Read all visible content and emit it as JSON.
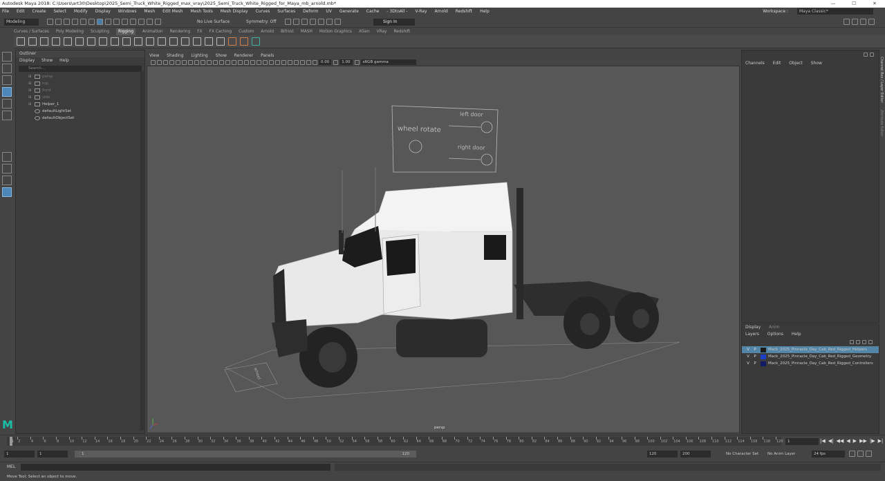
{
  "window": {
    "title": "Autodesk Maya 2018: C:\\Users\\art30\\Desktop\\2025_Semi_Truck_White_Rigged_max_vray\\2025_Semi_Truck_White_Rigged_for_Maya_mb_arnold.mb*",
    "minimize": "—",
    "maximize": "☐",
    "close": "✕"
  },
  "menus": [
    "File",
    "Edit",
    "Create",
    "Select",
    "Modify",
    "Display",
    "Windows",
    "Mesh",
    "Edit Mesh",
    "Mesh Tools",
    "Mesh Display",
    "Curves",
    "Surfaces",
    "Deform",
    "UV",
    "Generate",
    "Cache",
    "- 3DtoAll -",
    "V-Ray",
    "Arnold",
    "Redshift",
    "Help"
  ],
  "workspace": {
    "label": "Workspace :",
    "value": "Maya Classic*"
  },
  "status": {
    "mode": "Modeling",
    "live_surface": "No Live Surface",
    "symmetry": "Symmetry: Off",
    "sign_in": "Sign In"
  },
  "shelf_tabs": [
    {
      "label": "Curves / Surfaces"
    },
    {
      "label": "Poly Modeling"
    },
    {
      "label": "Sculpting"
    },
    {
      "label": "Rigging",
      "active": true
    },
    {
      "label": "Animation"
    },
    {
      "label": "Rendering"
    },
    {
      "label": "FX"
    },
    {
      "label": "FX Caching"
    },
    {
      "label": "Custom"
    },
    {
      "label": "Arnold"
    },
    {
      "label": "Bifrost"
    },
    {
      "label": "MASH"
    },
    {
      "label": "Motion Graphics"
    },
    {
      "label": "XGen"
    },
    {
      "label": "VRay"
    },
    {
      "label": "Redshift"
    }
  ],
  "outliner": {
    "title": "Outliner",
    "menu": [
      "Display",
      "Show",
      "Help"
    ],
    "search_placeholder": "Search...",
    "items": [
      {
        "label": "persp",
        "dim": true,
        "expandable": true
      },
      {
        "label": "top",
        "dim": true,
        "expandable": true
      },
      {
        "label": "front",
        "dim": true,
        "expandable": true
      },
      {
        "label": "side",
        "dim": true,
        "expandable": true
      },
      {
        "label": "Helper_1",
        "dim": false,
        "expandable": true
      },
      {
        "label": "defaultLightSet",
        "dim": false,
        "expandable": false
      },
      {
        "label": "defaultObjectSet",
        "dim": false,
        "expandable": false
      }
    ]
  },
  "viewport": {
    "menu": [
      "View",
      "Shading",
      "Lighting",
      "Show",
      "Renderer",
      "Panels"
    ],
    "exposure": "0.00",
    "gamma": "1.00",
    "color_space": "sRGB gamma",
    "camera": "persp",
    "helpers": {
      "wheel_rotate": "wheel rotate",
      "left_door": "left door",
      "right_door": "right door",
      "wheel_small": "wheel"
    }
  },
  "channel_box": {
    "menu": [
      "Channels",
      "Edit",
      "Object",
      "Show"
    ]
  },
  "side_tabs": [
    "Channel Box / Layer Editor",
    "Attribute Editor"
  ],
  "layers": {
    "tabs": [
      "Display",
      "Anim"
    ],
    "menu": [
      "Layers",
      "Options",
      "Help"
    ],
    "items": [
      {
        "v": "V",
        "p": "P",
        "name": "Mack_2025_Pinnacle_Day_Cab_Red_Rigged_Helpers",
        "color": "#1a1a1a",
        "selected": true
      },
      {
        "v": "V",
        "p": "P",
        "name": "Mack_2025_Pinnacle_Day_Cab_Red_Rigged_Geometry",
        "color": "#1f3fc7",
        "selected": false
      },
      {
        "v": "V",
        "p": "P",
        "name": "Mack_2025_Pinnacle_Day_Cab_Red_Rigged_Controllers",
        "color": "#131b66",
        "selected": false
      }
    ]
  },
  "timeline": {
    "ticks": [
      "1",
      "2",
      "4",
      "6",
      "8",
      "10",
      "12",
      "14",
      "16",
      "18",
      "20",
      "22",
      "24",
      "26",
      "28",
      "30",
      "32",
      "34",
      "36",
      "38",
      "40",
      "42",
      "44",
      "46",
      "48",
      "50",
      "52",
      "54",
      "56",
      "58",
      "60",
      "62",
      "64",
      "66",
      "68",
      "70",
      "72",
      "74",
      "76",
      "78",
      "80",
      "82",
      "84",
      "86",
      "88",
      "90",
      "92",
      "94",
      "96",
      "98",
      "100",
      "102",
      "104",
      "106",
      "108",
      "110",
      "112",
      "114",
      "116",
      "118",
      "120"
    ],
    "current_frame": "1",
    "range_start": "1",
    "range_start2": "1",
    "range_inner_start": "1",
    "range_inner_end": "120",
    "anim_end": "120",
    "anim_end2": "200",
    "character_set": "No Character Set",
    "anim_layer": "No Anim Layer",
    "fps": "24 fps",
    "playback": [
      "|◀",
      "◀|",
      "◀◀",
      "◀",
      "▶",
      "▶▶",
      "|▶",
      "▶|"
    ]
  },
  "mel": {
    "label": "MEL"
  },
  "help_line": "Move Tool: Select an object to move."
}
